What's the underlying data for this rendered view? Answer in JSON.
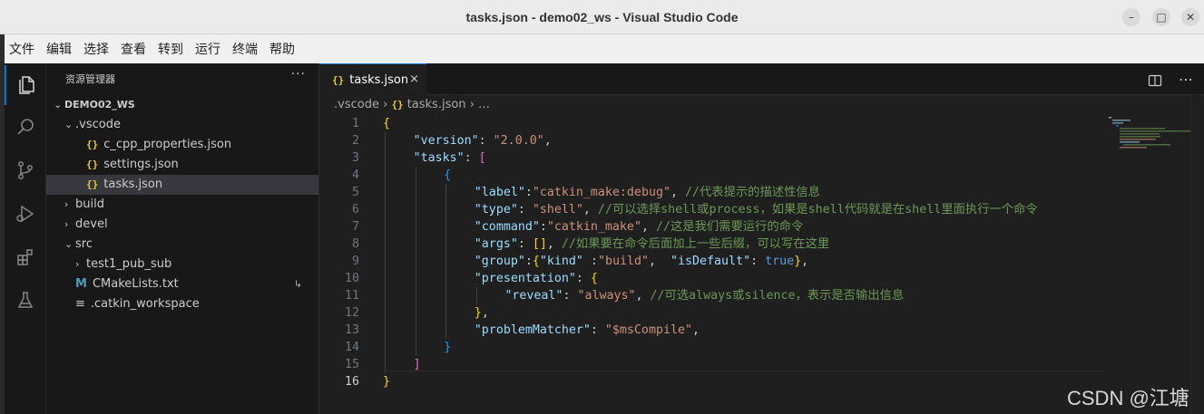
{
  "window": {
    "title": "tasks.json - demo02_ws - Visual Studio Code",
    "minimize": "–",
    "maximize": "□",
    "close": "✕"
  },
  "menu": [
    "文件",
    "编辑",
    "选择",
    "查看",
    "转到",
    "运行",
    "终端",
    "帮助"
  ],
  "explorer": {
    "header": "资源管理器",
    "more": "···",
    "items": [
      {
        "label": "DEMO02_WS",
        "depth": 0,
        "chevron": "⌄",
        "icon": "",
        "bold": true
      },
      {
        "label": ".vscode",
        "depth": 1,
        "chevron": "⌄",
        "icon": ""
      },
      {
        "label": "c_cpp_properties.json",
        "depth": 2,
        "chevron": "",
        "icon": "json"
      },
      {
        "label": "settings.json",
        "depth": 2,
        "chevron": "",
        "icon": "json"
      },
      {
        "label": "tasks.json",
        "depth": 2,
        "chevron": "",
        "icon": "json",
        "selected": true
      },
      {
        "label": "build",
        "depth": 1,
        "chevron": "›",
        "icon": ""
      },
      {
        "label": "devel",
        "depth": 1,
        "chevron": "›",
        "icon": ""
      },
      {
        "label": "src",
        "depth": 1,
        "chevron": "⌄",
        "icon": ""
      },
      {
        "label": "test1_pub_sub",
        "depth": 2,
        "chevron": "›",
        "icon": ""
      },
      {
        "label": "CMakeLists.txt",
        "depth": 1,
        "chevron": "",
        "icon": "cmake",
        "badge": "↳"
      },
      {
        "label": ".catkin_workspace",
        "depth": 1,
        "chevron": "",
        "icon": "file"
      }
    ]
  },
  "editor": {
    "tab_label": "tasks.json",
    "tab_close": "×",
    "json_icon": "{}",
    "breadcrumb": [
      ".vscode",
      "tasks.json",
      "…"
    ],
    "current_line": 16,
    "lines": [
      {
        "n": "1",
        "indent": 0,
        "tokens": [
          [
            "br1",
            "{"
          ]
        ]
      },
      {
        "n": "2",
        "indent": 1,
        "tokens": [
          [
            "k",
            "\"version\""
          ],
          [
            "p",
            ": "
          ],
          [
            "s",
            "\"2.0.0\""
          ],
          [
            "p",
            ","
          ]
        ]
      },
      {
        "n": "3",
        "indent": 1,
        "tokens": [
          [
            "k",
            "\"tasks\""
          ],
          [
            "p",
            ": "
          ],
          [
            "br2",
            "["
          ]
        ]
      },
      {
        "n": "4",
        "indent": 2,
        "tokens": [
          [
            "br3",
            "{"
          ]
        ]
      },
      {
        "n": "5",
        "indent": 3,
        "tokens": [
          [
            "k",
            "\"label\""
          ],
          [
            "p",
            ":"
          ],
          [
            "s",
            "\"catkin_make:debug\""
          ],
          [
            "p",
            ", "
          ],
          [
            "c",
            "//代表提示的描述性信息"
          ]
        ]
      },
      {
        "n": "6",
        "indent": 3,
        "tokens": [
          [
            "k",
            "\"type\""
          ],
          [
            "p",
            ": "
          ],
          [
            "s",
            "\"shell\""
          ],
          [
            "p",
            ", "
          ],
          [
            "c",
            "//可以选择shell或process，如果是shell代码就是在shell里面执行一个命令"
          ]
        ]
      },
      {
        "n": "7",
        "indent": 3,
        "tokens": [
          [
            "k",
            "\"command\""
          ],
          [
            "p",
            ":"
          ],
          [
            "s",
            "\"catkin_make\""
          ],
          [
            "p",
            ", "
          ],
          [
            "c",
            "//这是我们需要运行的命令"
          ]
        ]
      },
      {
        "n": "8",
        "indent": 3,
        "tokens": [
          [
            "k",
            "\"args\""
          ],
          [
            "p",
            ": "
          ],
          [
            "br1",
            "[]"
          ],
          [
            "p",
            ", "
          ],
          [
            "c",
            "//如果要在命令后面加上一些后缀，可以写在这里"
          ]
        ]
      },
      {
        "n": "9",
        "indent": 3,
        "tokens": [
          [
            "k",
            "\"group\""
          ],
          [
            "p",
            ":"
          ],
          [
            "br1",
            "{"
          ],
          [
            "k",
            "\"kind\""
          ],
          [
            "p",
            " :"
          ],
          [
            "s",
            "\"build\""
          ],
          [
            "p",
            ",  "
          ],
          [
            "k",
            "\"isDefault\""
          ],
          [
            "p",
            ": "
          ],
          [
            "b",
            "true"
          ],
          [
            "br1",
            "}"
          ],
          [
            "p",
            ","
          ]
        ]
      },
      {
        "n": "10",
        "indent": 3,
        "tokens": [
          [
            "k",
            "\"presentation\""
          ],
          [
            "p",
            ": "
          ],
          [
            "br1",
            "{"
          ]
        ]
      },
      {
        "n": "11",
        "indent": 4,
        "tokens": [
          [
            "k",
            "\"reveal\""
          ],
          [
            "p",
            ": "
          ],
          [
            "s",
            "\"always\""
          ],
          [
            "p",
            ", "
          ],
          [
            "c",
            "//可选always或silence，表示是否输出信息"
          ]
        ]
      },
      {
        "n": "12",
        "indent": 3,
        "tokens": [
          [
            "br1",
            "}"
          ],
          [
            "p",
            ","
          ]
        ]
      },
      {
        "n": "13",
        "indent": 3,
        "tokens": [
          [
            "k",
            "\"problemMatcher\""
          ],
          [
            "p",
            ": "
          ],
          [
            "s",
            "\"$msCompile\""
          ],
          [
            "p",
            ","
          ]
        ]
      },
      {
        "n": "14",
        "indent": 2,
        "tokens": [
          [
            "br3",
            "}"
          ]
        ]
      },
      {
        "n": "15",
        "indent": 1,
        "tokens": [
          [
            "br2",
            "]"
          ]
        ]
      },
      {
        "n": "16",
        "indent": 0,
        "tokens": [
          [
            "br1",
            "}"
          ]
        ]
      }
    ]
  },
  "watermark": "CSDN @江塘",
  "colors": {
    "accent": "#0078d4",
    "json_icon": "#e8c83a",
    "string": "#ce9178",
    "key": "#9cdcfe",
    "comment": "#6a9955"
  }
}
